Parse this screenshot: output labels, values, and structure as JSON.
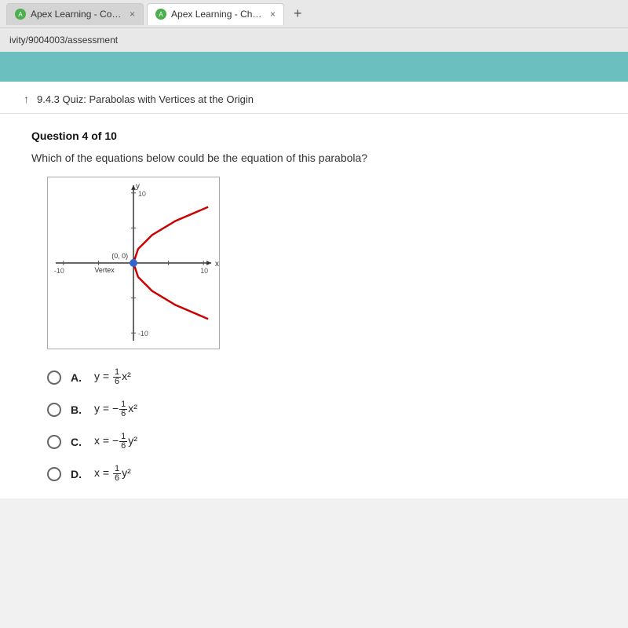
{
  "browser": {
    "tabs": [
      {
        "id": "tab1",
        "label": "Apex Learning - Courses",
        "active": false,
        "icon": "apex-icon"
      },
      {
        "id": "tab2",
        "label": "Apex Learning - Checkup",
        "active": true,
        "icon": "apex-icon"
      }
    ],
    "add_tab_label": "+",
    "address": "ivity/9004003/assessment"
  },
  "quiz": {
    "back_label": "↑",
    "title": "9.4.3 Quiz:  Parabolas with Vertices at the Origin",
    "question_number": "Question 4 of 10",
    "question_text": "Which of the equations below could be the equation of this parabola?",
    "graph": {
      "x_min": -10,
      "x_max": 10,
      "y_min": -10,
      "y_max": 10,
      "vertex_label": "(0, 0)",
      "vertex_x_label": "Vertex",
      "x_axis_label": "x",
      "y_axis_label": "y",
      "tick_labels": {
        "left": "-10",
        "right": "10",
        "top": "10",
        "bottom": "-10"
      }
    },
    "answers": [
      {
        "id": "A",
        "label": "A.",
        "equation_text": "y = (1/6)x²",
        "equation_html": "y&nbsp;=&nbsp;<span class='fraction'><span class='num'>1</span><span class='den'>6</span></span>x²"
      },
      {
        "id": "B",
        "label": "B.",
        "equation_text": "y = -(1/6)x²",
        "equation_html": "y&nbsp;=&nbsp;−<span class='fraction'><span class='num'>1</span><span class='den'>6</span></span>x²"
      },
      {
        "id": "C",
        "label": "C.",
        "equation_text": "x = -(1/6)y²",
        "equation_html": "x&nbsp;=&nbsp;−<span class='fraction'><span class='num'>1</span><span class='den'>6</span></span>y²"
      },
      {
        "id": "D",
        "label": "D.",
        "equation_text": "x = (1/6)y²",
        "equation_html": "x&nbsp;=&nbsp;<span class='fraction'><span class='num'>1</span><span class='den'>6</span></span>y²"
      }
    ]
  }
}
